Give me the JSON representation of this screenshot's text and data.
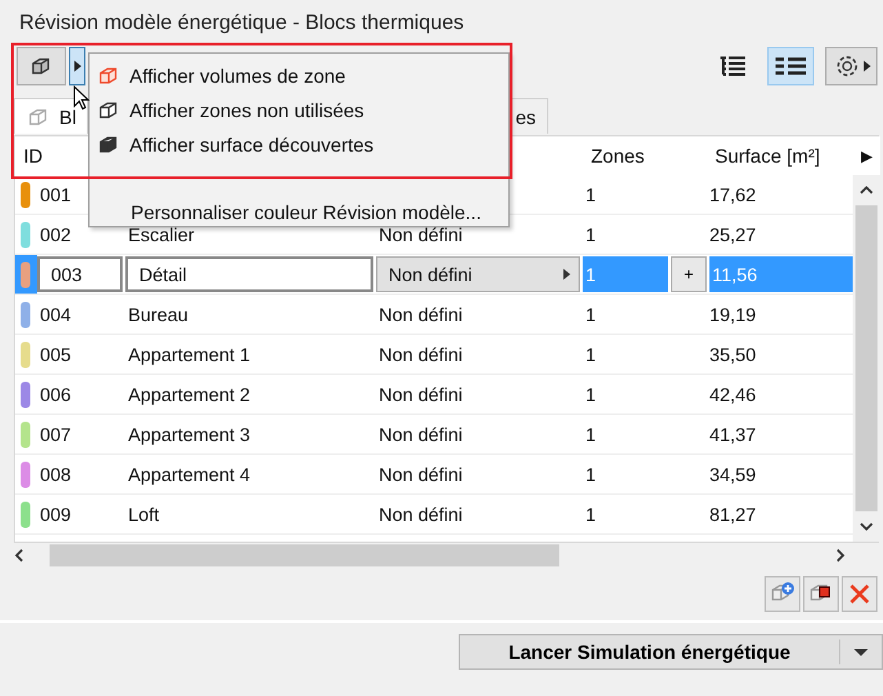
{
  "window": {
    "title": "Révision modèle énergétique - Blocs thermiques"
  },
  "toolbar": {
    "view_buttons": [
      {
        "kind": "tree",
        "selected": false
      },
      {
        "kind": "list",
        "selected": true
      }
    ]
  },
  "tabs": [
    {
      "label": "Bl",
      "selected": true
    },
    {
      "label": "es",
      "selected": false
    }
  ],
  "table": {
    "columns": [
      "ID",
      "Zones",
      "Surface [m²]"
    ],
    "next_column_arrow": "▶",
    "rows": [
      {
        "id": "001",
        "zones": "1",
        "surface": "17,62",
        "color": "#e8900c",
        "selected": false
      },
      {
        "id": "002",
        "name": "Escalier",
        "category": "Non défini",
        "zones": "1",
        "surface": "25,27",
        "color": "#7fdede",
        "selected": false
      },
      {
        "id": "003",
        "name": "Détail",
        "category": "Non défini",
        "zones": "1",
        "surface": "11,56",
        "color": "#e8a080",
        "selected": true
      },
      {
        "id": "004",
        "name": "Bureau",
        "category": "Non défini",
        "zones": "1",
        "surface": "19,19",
        "color": "#8fb0e8",
        "selected": false
      },
      {
        "id": "005",
        "name": "Appartement 1",
        "category": "Non défini",
        "zones": "1",
        "surface": "35,50",
        "color": "#e6dc8c",
        "selected": false
      },
      {
        "id": "006",
        "name": "Appartement 2",
        "category": "Non défini",
        "zones": "1",
        "surface": "42,46",
        "color": "#9c88e6",
        "selected": false
      },
      {
        "id": "007",
        "name": "Appartement 3",
        "category": "Non défini",
        "zones": "1",
        "surface": "41,37",
        "color": "#b4e48c",
        "selected": false
      },
      {
        "id": "008",
        "name": "Appartement 4",
        "category": "Non défini",
        "zones": "1",
        "surface": "34,59",
        "color": "#dc8ce6",
        "selected": false
      },
      {
        "id": "009",
        "name": "Loft",
        "category": "Non défini",
        "zones": "1",
        "surface": "81,27",
        "color": "#8ce08c",
        "selected": false
      }
    ],
    "add_button": "+"
  },
  "menu": {
    "items": [
      {
        "label": "Afficher volumes de zone",
        "kind": "volumes"
      },
      {
        "label": "Afficher zones non utilisées",
        "kind": "unused"
      },
      {
        "label": "Afficher surface découvertes",
        "kind": "uncovered"
      }
    ],
    "extra_item": "Personnaliser couleur Révision modèle..."
  },
  "footer": {
    "run_button": "Lancer Simulation énergétique"
  }
}
